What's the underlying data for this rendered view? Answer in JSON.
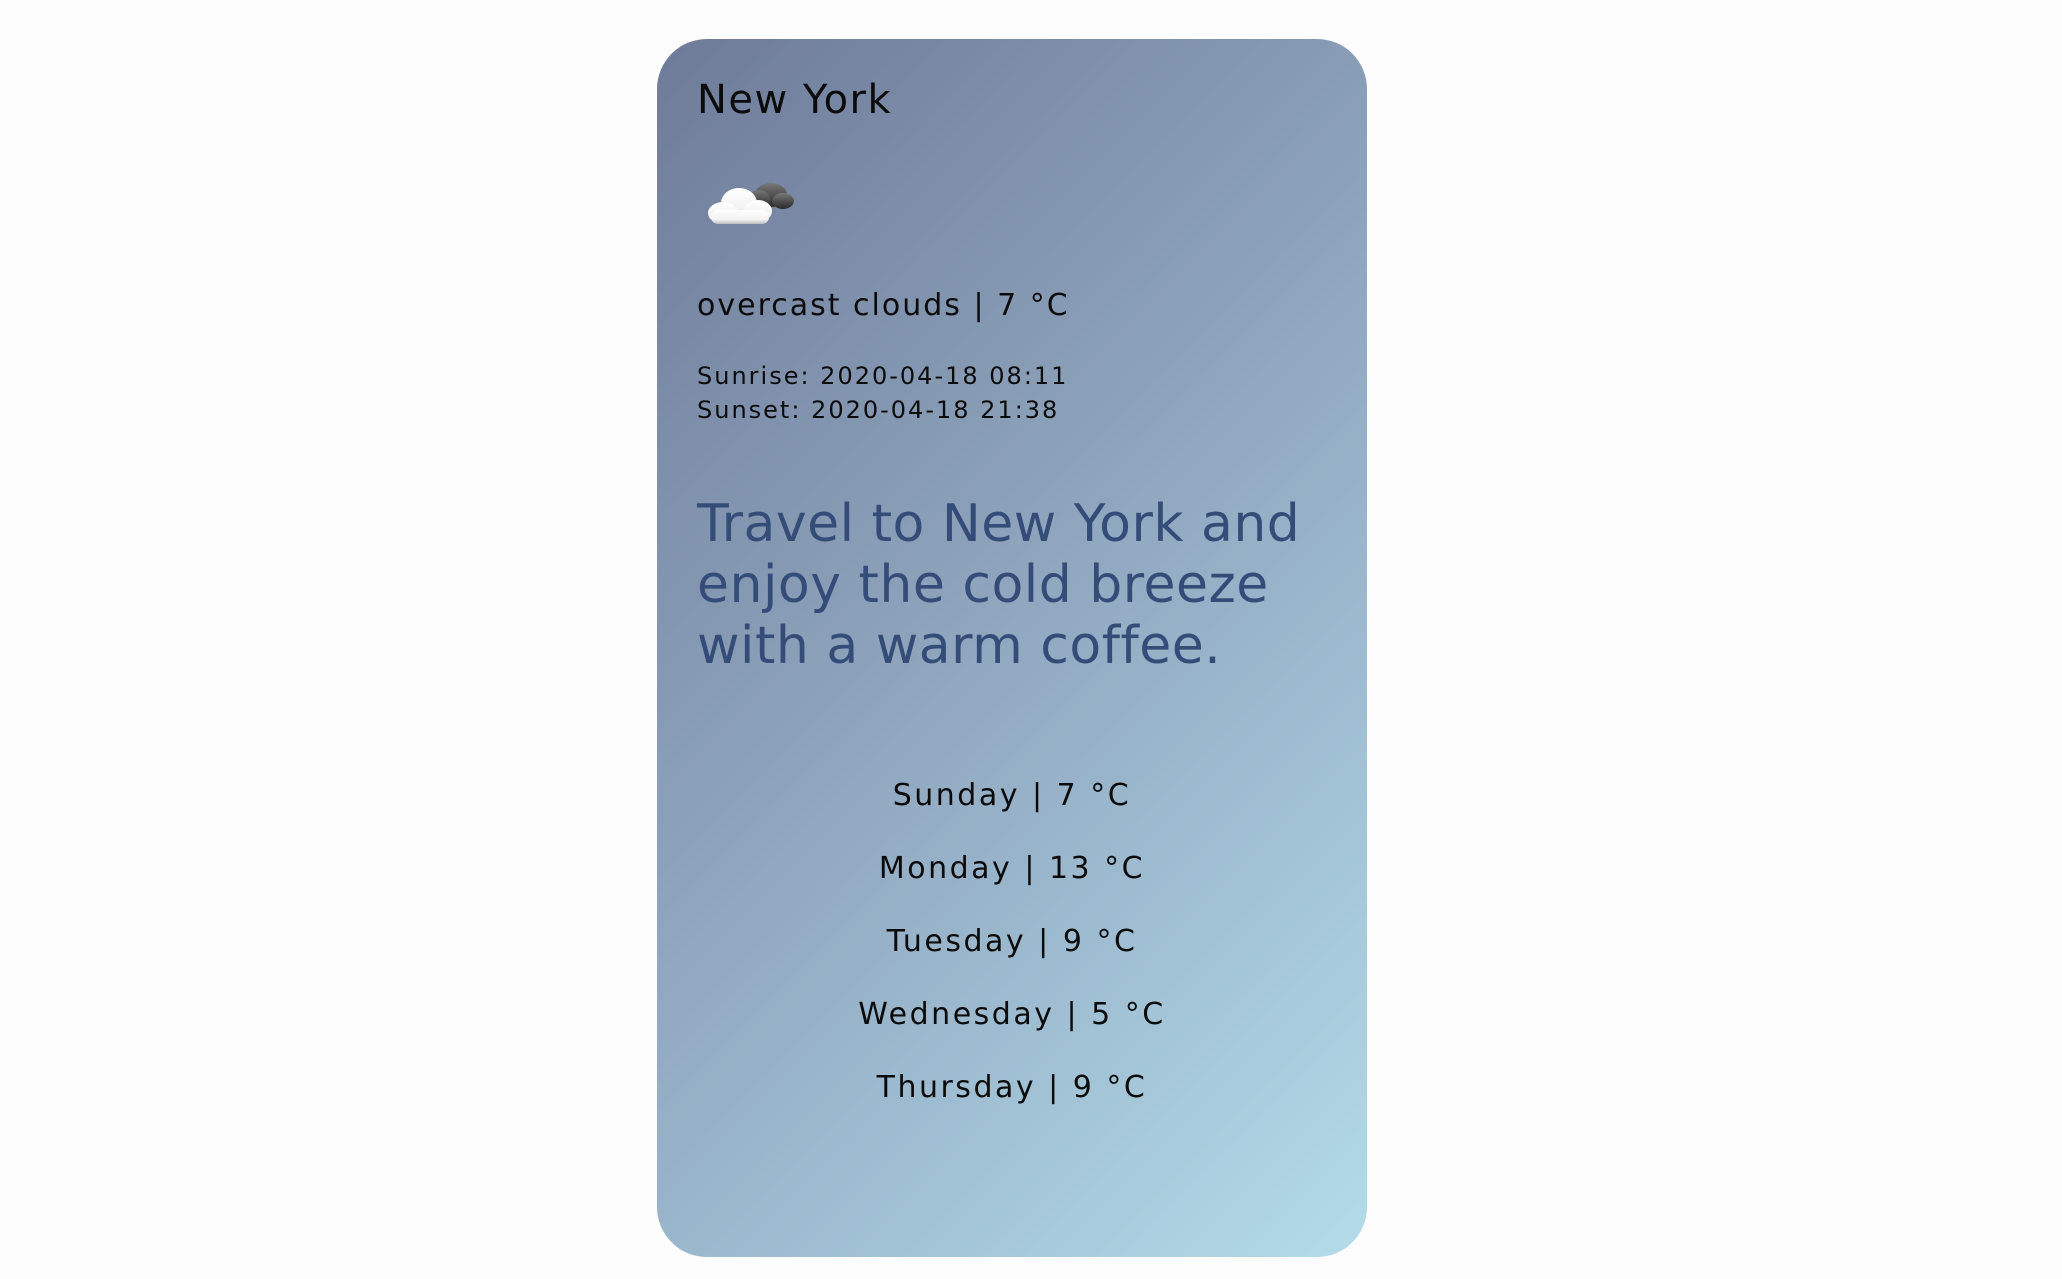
{
  "city": "New York",
  "weather": {
    "icon": "cloud-icon",
    "summary": "overcast clouds | 7 °C",
    "sunrise": "Sunrise: 2020-04-18 08:11",
    "sunset": "Sunset: 2020-04-18 21:38"
  },
  "tagline": "Travel to New York and enjoy the cold breeze with a warm coffee.",
  "forecast": [
    {
      "label": "Sunday | 7 °C"
    },
    {
      "label": "Monday | 13 °C"
    },
    {
      "label": "Tuesday | 9 °C"
    },
    {
      "label": "Wednesday | 5 °C"
    },
    {
      "label": "Thursday | 9 °C"
    }
  ],
  "colors": {
    "card_gradient_start": "#6e7b99",
    "card_gradient_end": "#b3dce9",
    "tagline": "#344c78",
    "text": "#0b0b0b"
  }
}
